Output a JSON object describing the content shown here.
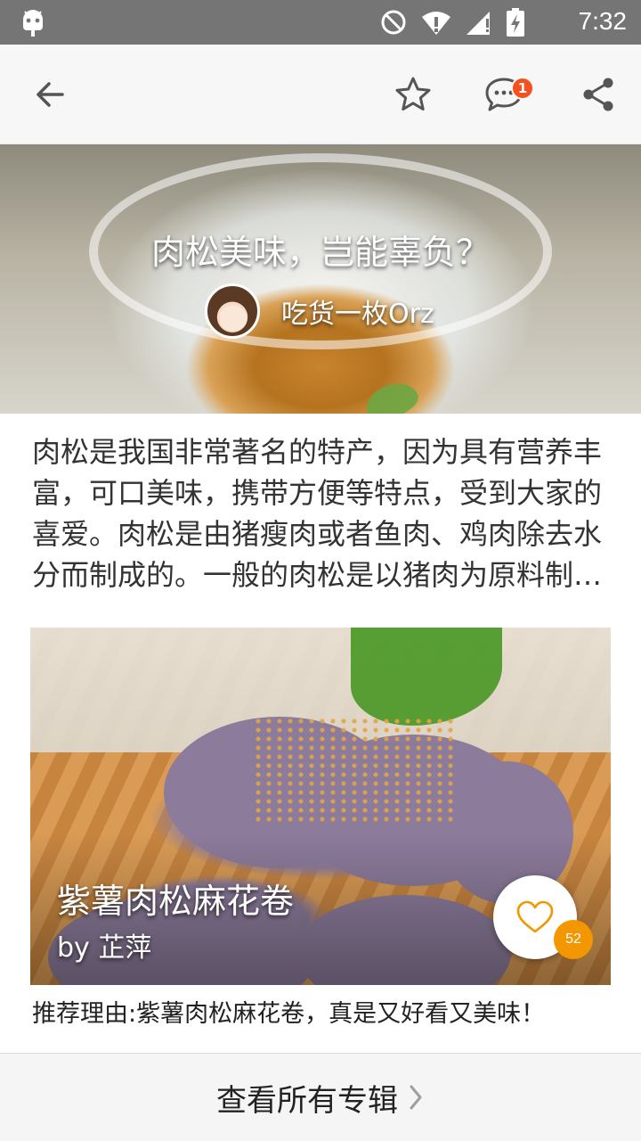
{
  "status_bar": {
    "time": "7:32",
    "icons": [
      "android-debug-icon",
      "do-not-disturb-icon",
      "wifi-warning-icon",
      "signal-icon",
      "battery-charging-icon"
    ]
  },
  "toolbar": {
    "back_icon": "arrow-left-icon",
    "favorite_icon": "star-outline-icon",
    "comment_icon": "comment-bubble-icon",
    "comment_badge": "1",
    "share_icon": "share-icon",
    "accent_color": "#f4511e"
  },
  "hero": {
    "title": "肉松美味，岂能辜负？",
    "author_name": "吃货一枚Orz"
  },
  "intro_text": "肉松是我国非常著名的特产，因为具有营养丰富，可口美味，携带方便等特点，受到大家的喜爱。肉松是由猪瘦肉或者鱼肉、鸡肉除去水分而制成的。一般的肉松是以猪肉为原料制作的，下面就给大家介绍几款肉松美食。",
  "recipe": {
    "title": "紫薯肉松麻花卷",
    "author": "by 芷萍",
    "like_icon": "heart-outline-icon",
    "like_count": "52",
    "like_color": "#f39700",
    "reason": "推荐理由:紫薯肉松麻花卷，真是又好看又美味！"
  },
  "footer": {
    "label": "查看所有专辑",
    "chevron_icon": "chevron-right-icon"
  }
}
